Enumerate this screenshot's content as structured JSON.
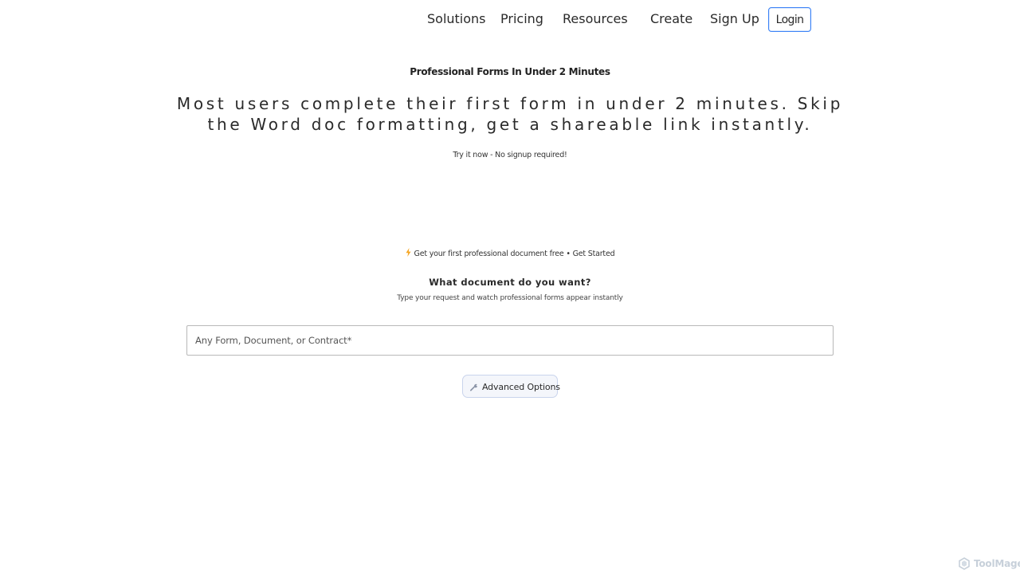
{
  "nav": {
    "items": [
      {
        "label": "Solutions"
      },
      {
        "label": "Pricing"
      },
      {
        "label": "Resources"
      },
      {
        "label": "Create"
      },
      {
        "label": "Sign Up"
      }
    ],
    "login_label": "Login",
    "accent_color": "#3b82f6"
  },
  "hero": {
    "eyebrow": "Professional Forms In Under 2 Minutes",
    "headline": "Most users complete their first form in under 2 minutes. Skip the Word doc formatting, get a shareable link instantly.",
    "try_note": "Try it now - No signup required!"
  },
  "promo": {
    "icon": "lightning-bolt-icon",
    "icon_color": "#f5a623",
    "text": "Get your first professional document free",
    "separator": "•",
    "link": "Get Started"
  },
  "builder": {
    "title": "What document do you want?",
    "subtitle": "Type your request and watch professional forms appear instantly",
    "field_label": "Any Form, Document, or Contract",
    "required_mark": "*",
    "advanced_label": "Advanced Options",
    "advanced_icon": "wrench-icon"
  },
  "watermark": {
    "text": "ToolMage",
    "icon": "toolmage-logo-icon"
  }
}
